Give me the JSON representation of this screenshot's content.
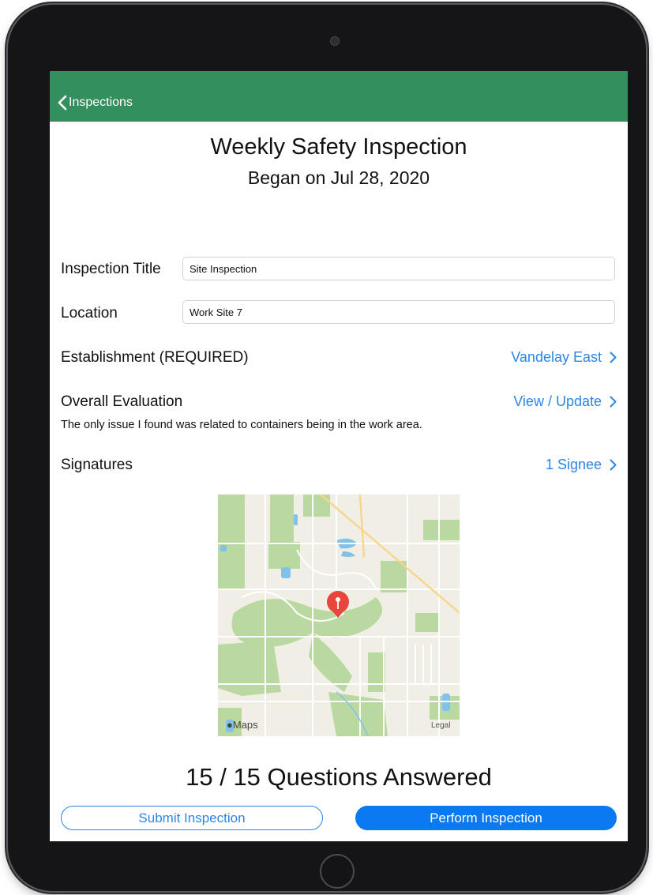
{
  "navbar": {
    "back_label": "Inspections",
    "color": "#348f5e"
  },
  "header": {
    "title": "Weekly Safety Inspection",
    "subtitle": "Began on Jul 28, 2020"
  },
  "form": {
    "inspection_title_label": "Inspection Title",
    "inspection_title_value": "Site Inspection",
    "location_label": "Location",
    "location_value": "Work Site 7",
    "establishment_label": "Establishment (REQUIRED)",
    "establishment_value": "Vandelay East",
    "evaluation_label": "Overall Evaluation",
    "evaluation_value": "View / Update",
    "evaluation_note": "The only issue I found was related to containers being in the work area.",
    "signatures_label": "Signatures",
    "signatures_value": "1 Signee"
  },
  "map": {
    "logo": "Maps",
    "legal": "Legal",
    "pin_color": "#e8453c",
    "park_color": "#b9d9a0",
    "water_color": "#7fc3ec",
    "land_color": "#f1eee6"
  },
  "progress": {
    "text": "15 / 15 Questions Answered"
  },
  "actions": {
    "submit_label": "Submit Inspection",
    "perform_label": "Perform Inspection",
    "accent": "#2b86e6"
  }
}
